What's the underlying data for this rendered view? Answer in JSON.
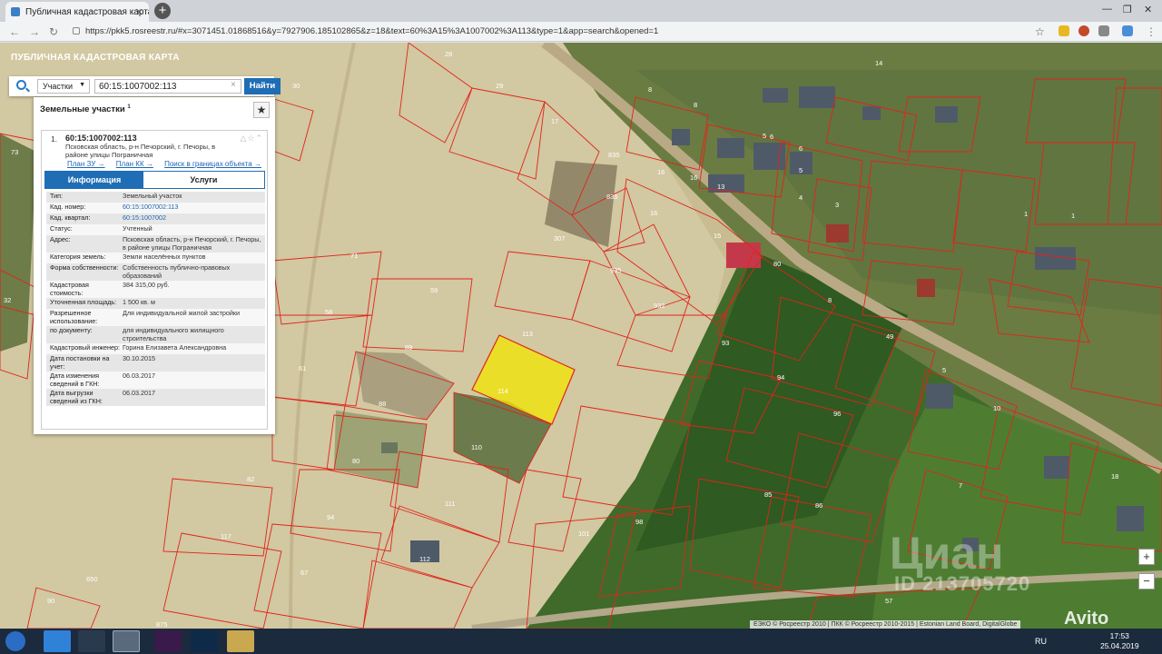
{
  "browser": {
    "tab_title": "Публичная кадастровая карта",
    "tab_close": "✕",
    "new_tab": "+",
    "url": "https://pkk5.rosreestr.ru/#x=3071451.01868516&y=7927906.185102865&z=18&text=60%3A15%3A1007002%3A113&type=1&app=search&opened=1"
  },
  "app": {
    "title": "ПУБЛИЧНАЯ КАДАСТРОВАЯ КАРТА"
  },
  "search": {
    "type_label": "Участки",
    "query": "60:15:1007002:113",
    "clear": "×",
    "button": "Найти"
  },
  "panel": {
    "heading": "Земельные участки",
    "heading_count": "1",
    "result": {
      "index": "1.",
      "title": "60:15:1007002:113",
      "address": "Псковская область, р-н Печорский, г. Печоры, в районе улицы Пограничная",
      "links": [
        "План ЗУ →",
        "План КК →",
        "Поиск в границах объекта →"
      ]
    },
    "tabs": [
      "Информация",
      "Услуги"
    ],
    "info": [
      {
        "k": "Тип:",
        "v": "Земельный участок"
      },
      {
        "k": "Кад. номер:",
        "v": "60:15:1007002:113",
        "link": true
      },
      {
        "k": "Кад. квартал:",
        "v": "60:15:1007002",
        "link": true
      },
      {
        "k": "Статус:",
        "v": "Учтенный"
      },
      {
        "k": "Адрес:",
        "v": "Псковская область, р-н Печорский, г. Печоры, в районе улицы Пограничная"
      },
      {
        "k": "Категория земель:",
        "v": "Земли населённых пунктов"
      },
      {
        "k": "Форма собственности:",
        "v": "Собственность публично-правовых образований"
      },
      {
        "k": "Кадастровая стоимость:",
        "v": "384 315,00 руб."
      },
      {
        "k": "Уточненная площадь:",
        "v": "1 500 кв. м"
      },
      {
        "k": "Разрешенное использование:",
        "v": "Для индивидуальной жилой застройки"
      },
      {
        "k": "по документу:",
        "v": "для индивидуального жилищного строительства"
      },
      {
        "k": "Кадастровый инженер:",
        "v": "Горина Елизавета Александровна"
      },
      {
        "k": "Дата постановки на учет:",
        "v": "30.10.2015"
      },
      {
        "k": "Дата изменения сведений в ГКН:",
        "v": "06.03.2017"
      },
      {
        "k": "Дата выгрузки сведений из ГКН:",
        "v": "06.03.2017"
      }
    ]
  },
  "map": {
    "attribution": "ЕЭКО © Росреестр 2010 | ПКК © Росреестр 2010-2015 | Estonian Land Board, DigitalGlobe",
    "zoom_in": "+",
    "zoom_out": "−",
    "watermark": "Циан",
    "watermark_id": "ID 213705720",
    "avito": "Avito",
    "selected_color": "#f2e600",
    "boundary_color": "#e0241c",
    "plot_labels": [
      "28",
      "29",
      "17",
      "30",
      "835",
      "835",
      "16",
      "16",
      "16",
      "15",
      "13",
      "8",
      "8",
      "5",
      "4",
      "6",
      "6",
      "5",
      "3",
      "14",
      "1",
      "1",
      "307",
      "935",
      "932",
      "71",
      "59",
      "58",
      "113",
      "89",
      "114",
      "61",
      "88",
      "110",
      "80",
      "111",
      "94",
      "117",
      "82",
      "67",
      "112",
      "101",
      "650",
      "90",
      "875",
      "80",
      "8",
      "49",
      "93",
      "94",
      "96",
      "98",
      "85",
      "86",
      "5",
      "10",
      "7",
      "18",
      "57",
      "73",
      "32"
    ]
  },
  "taskbar": {
    "lang": "RU",
    "time": "17:53",
    "date": "25.04.2019"
  }
}
